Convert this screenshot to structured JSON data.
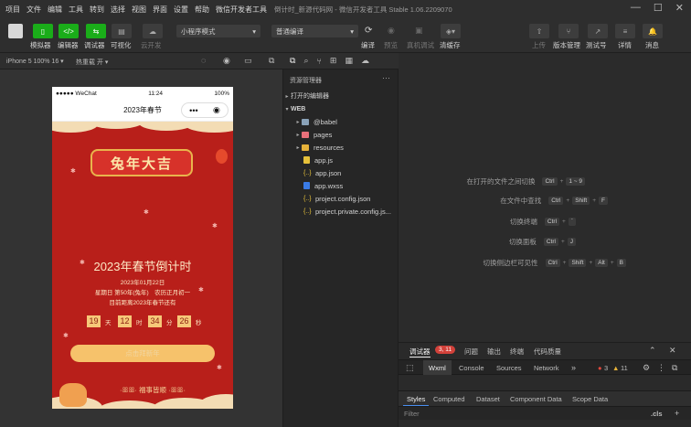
{
  "menubar": {
    "items": [
      "项目",
      "文件",
      "编辑",
      "工具",
      "转到",
      "选择",
      "视图",
      "界面",
      "设置",
      "帮助",
      "微信开发者工具"
    ],
    "title": "倒计时_新源代码网 - 微信开发者工具 Stable 1.06.2209070",
    "controls": [
      "—",
      "☐",
      "✕"
    ]
  },
  "toolbar": {
    "simulator": "模拟器",
    "editor": "编辑器",
    "debugger": "调试器",
    "visual": "可视化",
    "cloud": "云开发",
    "mode_select": "小程序模式",
    "compile_select": "普通编译",
    "compile": "编译",
    "preview": "预览",
    "remote_debug": "真机调试",
    "clear_cache": "清缓存",
    "upload": "上传",
    "version": "版本管理",
    "test": "测试号",
    "details": "详情",
    "messages": "消息"
  },
  "subbar": {
    "device": "iPhone 5 100% 16 ▾",
    "hotreload": "热重载 开 ▾"
  },
  "phone": {
    "carrier": "●●●●● WeChat",
    "time": "11:24",
    "battery": "100%",
    "nav_title": "2023年春节",
    "capsule_more": "•••",
    "capsule_close": "◉"
  },
  "poster": {
    "banner": "兔年大吉",
    "headline": "2023年春节倒计时",
    "date": "2023年01月22日",
    "weekday_line": "星期日 第50年(兔年)　农历正月初一",
    "until_line": "目前距离2023年春节还有",
    "days": "19",
    "days_unit": "天",
    "hours": "12",
    "hours_unit": "时",
    "minutes": "34",
    "minutes_unit": "分",
    "seconds": "26",
    "seconds_unit": "秒",
    "button": "点击拜新年",
    "blessing": "·ꕥꕥ· 福事皆顺 ·ꕥꕥ·"
  },
  "explorer": {
    "header": "资源管理器",
    "more": "···",
    "open_editors": "打开的编辑器",
    "root": "WEB",
    "items": [
      "@babel",
      "pages",
      "resources",
      "app.js",
      "app.json",
      "app.wxss",
      "project.config.json",
      "project.private.config.js..."
    ]
  },
  "editor": {
    "shortcuts": [
      {
        "label": "在打开的文件之间切换",
        "keys": [
          "Ctrl",
          "1 ~ 9"
        ]
      },
      {
        "label": "在文件中查找",
        "keys": [
          "Ctrl",
          "Shift",
          "F"
        ]
      },
      {
        "label": "切换终端",
        "keys": [
          "Ctrl",
          "`"
        ]
      },
      {
        "label": "切换面板",
        "keys": [
          "Ctrl",
          "J"
        ]
      },
      {
        "label": "切换侧边栏可见性",
        "keys": [
          "Ctrl",
          "Shift",
          "Alt",
          "B"
        ]
      }
    ]
  },
  "devtools": {
    "tabs": [
      "调试器",
      "问题",
      "输出",
      "终端",
      "代码质量"
    ],
    "badge": "3, 11",
    "panels": [
      "Wxml",
      "Console",
      "Sources",
      "Network"
    ],
    "more": "»",
    "errors": "3",
    "warnings": "11",
    "subtabs": [
      "Styles",
      "Computed",
      "Dataset",
      "Component Data",
      "Scope Data"
    ],
    "filter_placeholder": "Filter",
    "cls": ".cls",
    "plus": "+"
  }
}
